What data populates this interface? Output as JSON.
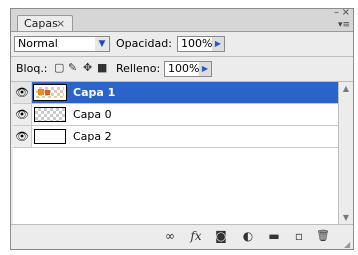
{
  "tab": {
    "label": "Capas",
    "close": "×"
  },
  "window": {
    "minimize": "–",
    "close": "×",
    "menu": "▾≡"
  },
  "options": {
    "blend_mode": "Normal",
    "opacity_label": "Opacidad:",
    "opacity_value": "100%",
    "lock_label": "Bloq.:",
    "fill_label": "Relleno:",
    "fill_value": "100%"
  },
  "layers": [
    {
      "name": "Capa 1",
      "selected": true
    },
    {
      "name": "Capa 0",
      "selected": false
    },
    {
      "name": "Capa 2",
      "selected": false
    }
  ],
  "icons": {
    "eye": "●",
    "link": "∞",
    "fx": "fx",
    "mask": "◙",
    "adjust": "◐",
    "group": "▬",
    "new": "▫",
    "trash": "🗑"
  }
}
